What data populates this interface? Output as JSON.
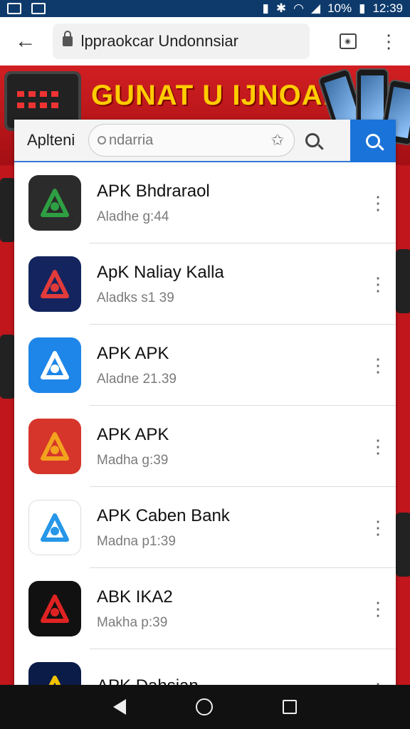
{
  "status_bar": {
    "battery": "10%",
    "time": "12:39",
    "icons": [
      "notification-icon",
      "image-icon",
      "vibrate-icon",
      "bluetooth-icon",
      "wifi-icon",
      "signal-icon",
      "battery-icon"
    ]
  },
  "browser": {
    "url": "lppraokcar Undonnsiar"
  },
  "banner": {
    "title": "GUNAT U IJNOANIAN"
  },
  "search": {
    "label": "Aplteni",
    "placeholder": "ndarria"
  },
  "apps": [
    {
      "title": "APK Bhdraraol",
      "subtitle": "Aladhe g:44",
      "icon": "triangle-logo-icon",
      "color": "#2b2b2b",
      "accent": "#2ea043"
    },
    {
      "title": "ApK Naliay Kalla",
      "subtitle": "Aladks s1 39",
      "icon": "navy-a-logo-icon",
      "color": "#13245e",
      "accent": "#e03a3a"
    },
    {
      "title": "APK APK",
      "subtitle": "Aladne 21.39",
      "icon": "blue-a-logo-icon",
      "color": "#1e86e8",
      "accent": "#ffffff"
    },
    {
      "title": "APK APK",
      "subtitle": "Madha g:39",
      "icon": "red-orange-logo-icon",
      "color": "#d6352b",
      "accent": "#f3a21e"
    },
    {
      "title": "APK Caben Bank",
      "subtitle": "Madna p1:39",
      "icon": "blue-ring-logo-icon",
      "color": "#ffffff",
      "accent": "#2696e8"
    },
    {
      "title": "ABK IKA2",
      "subtitle": "Makha p:39",
      "icon": "red-pin-logo-icon",
      "color": "#111111",
      "accent": "#e02222"
    },
    {
      "title": "APK Dahsian",
      "subtitle": "",
      "icon": "yellow-emblem-logo-icon",
      "color": "#0b1c48",
      "accent": "#f2c200"
    }
  ]
}
